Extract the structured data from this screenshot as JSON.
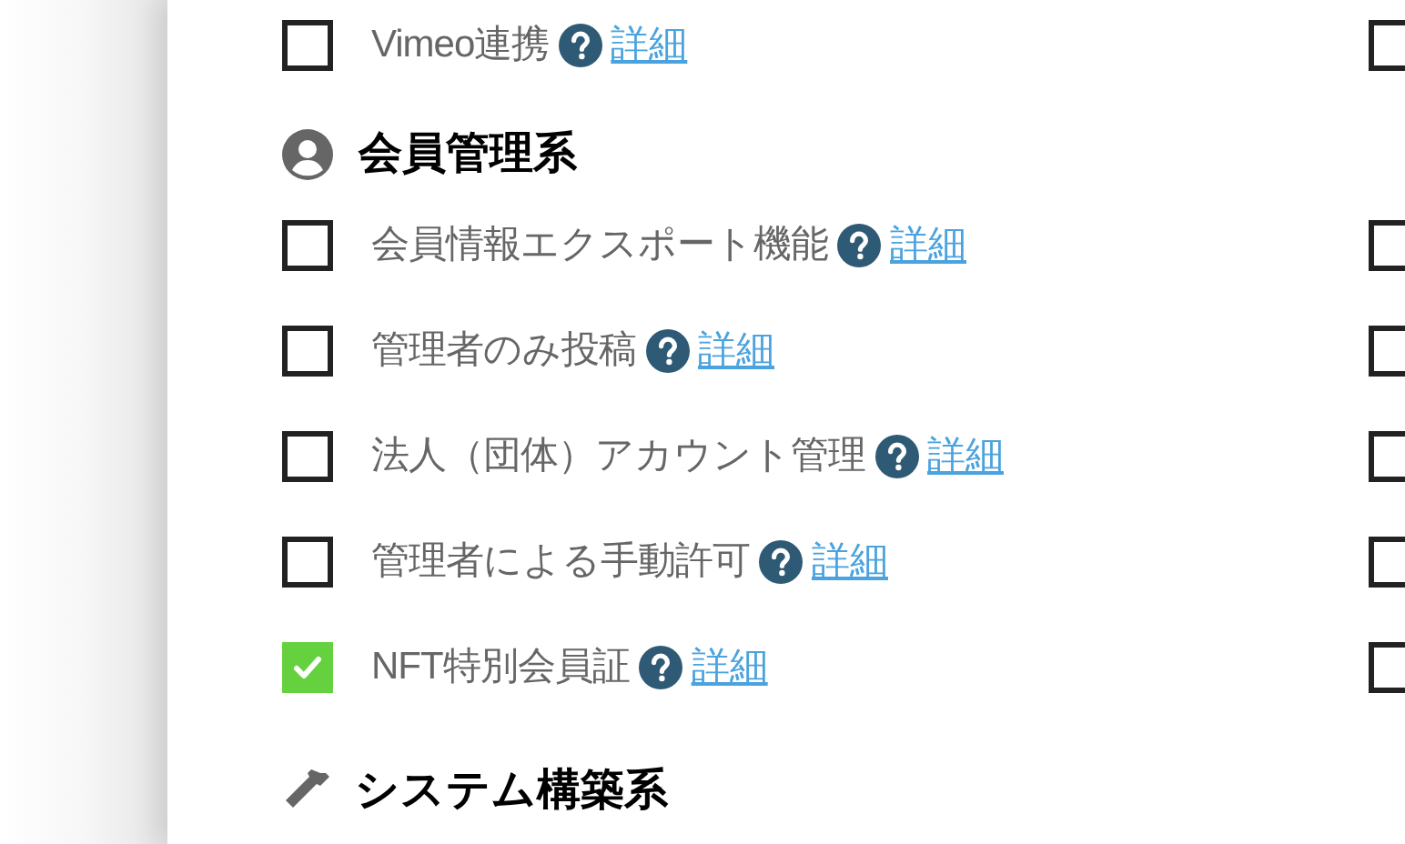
{
  "sections": [
    {
      "items": [
        {
          "label": "Vimeo連携",
          "checked": false,
          "link": "詳細",
          "right_checked": false
        }
      ]
    },
    {
      "title": "会員管理系",
      "items": [
        {
          "label": "会員情報エクスポート機能",
          "checked": false,
          "link": "詳細",
          "right_checked": false
        },
        {
          "label": "管理者のみ投稿",
          "checked": false,
          "link": "詳細",
          "right_checked": false
        },
        {
          "label": "法人（団体）アカウント管理",
          "checked": false,
          "link": "詳細",
          "right_checked": false
        },
        {
          "label": "管理者による手動許可",
          "checked": false,
          "link": "詳細",
          "right_checked": false
        },
        {
          "label": "NFT特別会員証",
          "checked": true,
          "link": "詳細",
          "right_checked": false
        }
      ]
    },
    {
      "title": "システム構築系"
    }
  ]
}
